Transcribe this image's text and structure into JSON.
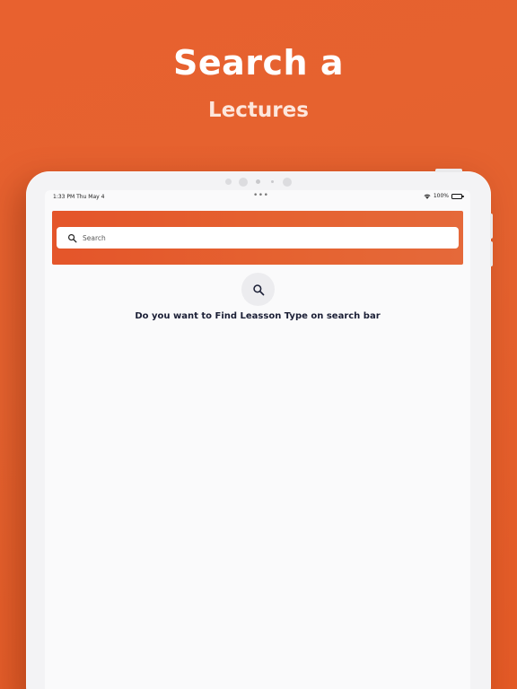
{
  "promo": {
    "title": "Search a",
    "subtitle": "Lectures"
  },
  "status_bar": {
    "time": "1:33 PM  Thu May 4",
    "dots": "•••",
    "battery_text": "100%"
  },
  "search": {
    "placeholder": "Search",
    "value": ""
  },
  "empty_state": {
    "icon": "search-icon",
    "message": "Do you want to Find Leasson Type on search bar"
  },
  "colors": {
    "brand": "#e4552a",
    "message_text": "#1a1e35"
  }
}
